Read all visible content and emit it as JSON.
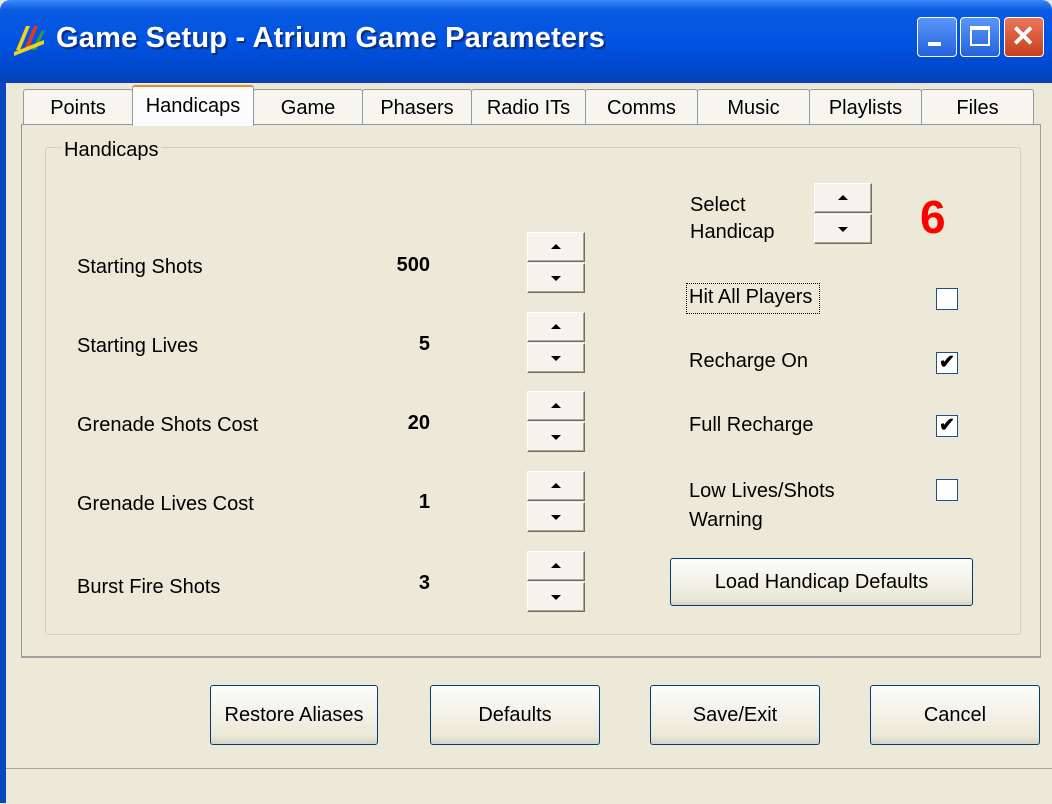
{
  "window": {
    "title": "Game Setup - Atrium Game Parameters",
    "icon": "atrium-app-icon",
    "controls": {
      "minimize": "minimize-icon",
      "maximize": "maximize-icon",
      "close": "close-icon",
      "close_glyph": "✕"
    }
  },
  "tabs": [
    {
      "label": "Points",
      "active": false
    },
    {
      "label": "Handicaps",
      "active": true
    },
    {
      "label": "Game",
      "active": false
    },
    {
      "label": "Phasers",
      "active": false
    },
    {
      "label": "Radio ITs",
      "active": false
    },
    {
      "label": "Comms",
      "active": false
    },
    {
      "label": "Music",
      "active": false
    },
    {
      "label": "Playlists",
      "active": false
    },
    {
      "label": "Files",
      "active": false
    }
  ],
  "handicaps": {
    "group_label": "Handicaps",
    "params": [
      {
        "label": "Starting Shots",
        "value": "500"
      },
      {
        "label": "Starting Lives",
        "value": "5"
      },
      {
        "label": "Grenade Shots Cost",
        "value": "20"
      },
      {
        "label": "Grenade Lives Cost",
        "value": "1"
      },
      {
        "label": "Burst Fire Shots",
        "value": "3"
      }
    ],
    "select_handicap": {
      "label_line1": "Select",
      "label_line2": "Handicap",
      "value": "6"
    },
    "options": [
      {
        "label": "Hit All Players",
        "checked": false
      },
      {
        "label": "Recharge On",
        "checked": true
      },
      {
        "label": "Full Recharge",
        "checked": true
      },
      {
        "label_line1": "Low Lives/Shots",
        "label_line2": "Warning",
        "checked": false
      }
    ],
    "checkmark": "✔",
    "load_defaults_button": "Load Handicap Defaults"
  },
  "footer_buttons": {
    "restore_aliases": "Restore Aliases",
    "defaults": "Defaults",
    "save_exit": "Save/Exit",
    "cancel": "Cancel"
  },
  "colors": {
    "title_bar": "#0054e3",
    "handicap_number": "#ff0000",
    "tab_highlight": "#e68b2c"
  }
}
